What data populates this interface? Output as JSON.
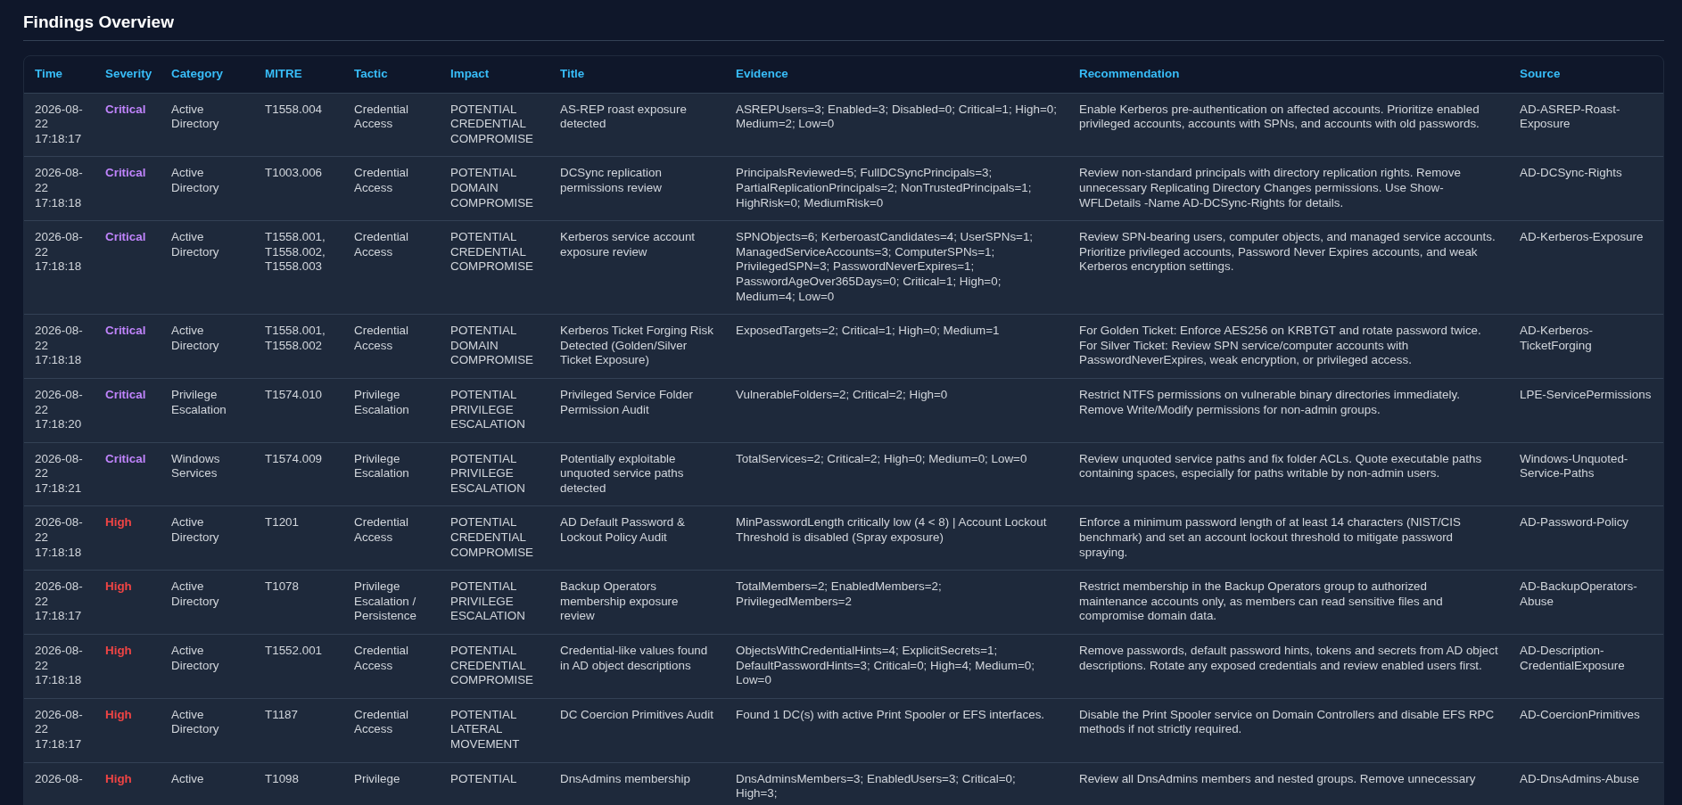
{
  "heading": "Findings Overview",
  "table": {
    "columns": [
      "Time",
      "Severity",
      "Category",
      "MITRE",
      "Tactic",
      "Impact",
      "Title",
      "Evidence",
      "Recommendation",
      "Source"
    ],
    "rows": [
      {
        "time": "2026-08-22 17:18:17",
        "severity": "Critical",
        "color": "#c084fc",
        "category": "Active Directory",
        "mitre": "T1558.004",
        "tactic": "Credential Access",
        "impact": "POTENTIAL CREDENTIAL COMPROMISE",
        "title": "AS-REP roast exposure detected",
        "evidence": "ASREPUsers=3; Enabled=3; Disabled=0; Critical=1; High=0; Medium=2; Low=0",
        "recommendation": "Enable Kerberos pre-authentication on affected accounts. Prioritize enabled privileged accounts, accounts with SPNs, and accounts with old passwords.",
        "source": "AD-ASREP-Roast-Exposure"
      },
      {
        "time": "2026-08-22 17:18:18",
        "severity": "Critical",
        "color": "#c084fc",
        "category": "Active Directory",
        "mitre": "T1003.006",
        "tactic": "Credential Access",
        "impact": "POTENTIAL DOMAIN COMPROMISE",
        "title": "DCSync replication permissions review",
        "evidence": "PrincipalsReviewed=5; FullDCSyncPrincipals=3; PartialReplicationPrincipals=2; NonTrustedPrincipals=1; HighRisk=0; MediumRisk=0",
        "recommendation": "Review non-standard principals with directory replication rights. Remove unnecessary Replicating Directory Changes permissions. Use Show-WFLDetails -Name AD-DCSync-Rights for details.",
        "source": "AD-DCSync-Rights"
      },
      {
        "time": "2026-08-22 17:18:18",
        "severity": "Critical",
        "color": "#c084fc",
        "category": "Active Directory",
        "mitre": "T1558.001, T1558.002, T1558.003",
        "tactic": "Credential Access",
        "impact": "POTENTIAL CREDENTIAL COMPROMISE",
        "title": "Kerberos service account exposure review",
        "evidence": "SPNObjects=6; KerberoastCandidates=4; UserSPNs=1; ManagedServiceAccounts=3; ComputerSPNs=1; PrivilegedSPN=3; PasswordNeverExpires=1; PasswordAgeOver365Days=0; Critical=1; High=0; Medium=4; Low=0",
        "recommendation": "Review SPN-bearing users, computer objects, and managed service accounts. Prioritize privileged accounts, Password Never Expires accounts, and weak Kerberos encryption settings.",
        "source": "AD-Kerberos-Exposure"
      },
      {
        "time": "2026-08-22 17:18:18",
        "severity": "Critical",
        "color": "#c084fc",
        "category": "Active Directory",
        "mitre": "T1558.001, T1558.002",
        "tactic": "Credential Access",
        "impact": "POTENTIAL DOMAIN COMPROMISE",
        "title": "Kerberos Ticket Forging Risk Detected (Golden/Silver Ticket Exposure)",
        "evidence": "ExposedTargets=2; Critical=1; High=0; Medium=1",
        "recommendation": "For Golden Ticket: Enforce AES256 on KRBTGT and rotate password twice. For Silver Ticket: Review SPN service/computer accounts with PasswordNeverExpires, weak encryption, or privileged access.",
        "source": "AD-Kerberos-TicketForging"
      },
      {
        "time": "2026-08-22 17:18:20",
        "severity": "Critical",
        "color": "#c084fc",
        "category": "Privilege Escalation",
        "mitre": "T1574.010",
        "tactic": "Privilege Escalation",
        "impact": "POTENTIAL PRIVILEGE ESCALATION",
        "title": "Privileged Service Folder Permission Audit",
        "evidence": "VulnerableFolders=2; Critical=2; High=0",
        "recommendation": "Restrict NTFS permissions on vulnerable binary directories immediately. Remove Write/Modify permissions for non-admin groups.",
        "source": "LPE-ServicePermissions"
      },
      {
        "time": "2026-08-22 17:18:21",
        "severity": "Critical",
        "color": "#c084fc",
        "category": "Windows Services",
        "mitre": "T1574.009",
        "tactic": "Privilege Escalation",
        "impact": "POTENTIAL PRIVILEGE ESCALATION",
        "title": "Potentially exploitable unquoted service paths detected",
        "evidence": "TotalServices=2; Critical=2; High=0; Medium=0; Low=0",
        "recommendation": "Review unquoted service paths and fix folder ACLs. Quote executable paths containing spaces, especially for paths writable by non-admin users.",
        "source": "Windows-Unquoted-Service-Paths"
      },
      {
        "time": "2026-08-22 17:18:18",
        "severity": "High",
        "color": "#ef4444",
        "category": "Active Directory",
        "mitre": "T1201",
        "tactic": "Credential Access",
        "impact": "POTENTIAL CREDENTIAL COMPROMISE",
        "title": "AD Default Password & Lockout Policy Audit",
        "evidence": "MinPasswordLength critically low (4 < 8) | Account Lockout Threshold is disabled (Spray exposure)",
        "recommendation": "Enforce a minimum password length of at least 14 characters (NIST/CIS benchmark) and set an account lockout threshold to mitigate password spraying.",
        "source": "AD-Password-Policy"
      },
      {
        "time": "2026-08-22 17:18:17",
        "severity": "High",
        "color": "#ef4444",
        "category": "Active Directory",
        "mitre": "T1078",
        "tactic": "Privilege Escalation / Persistence",
        "impact": "POTENTIAL PRIVILEGE ESCALATION",
        "title": "Backup Operators membership exposure review",
        "evidence": "TotalMembers=2; EnabledMembers=2; PrivilegedMembers=2",
        "recommendation": "Restrict membership in the Backup Operators group to authorized maintenance accounts only, as members can read sensitive files and compromise domain data.",
        "source": "AD-BackupOperators-Abuse"
      },
      {
        "time": "2026-08-22 17:18:18",
        "severity": "High",
        "color": "#ef4444",
        "category": "Active Directory",
        "mitre": "T1552.001",
        "tactic": "Credential Access",
        "impact": "POTENTIAL CREDENTIAL COMPROMISE",
        "title": "Credential-like values found in AD object descriptions",
        "evidence": "ObjectsWithCredentialHints=4; ExplicitSecrets=1; DefaultPasswordHints=3; Critical=0; High=4; Medium=0; Low=0",
        "recommendation": "Remove passwords, default password hints, tokens and secrets from AD object descriptions. Rotate any exposed credentials and review enabled users first.",
        "source": "AD-Description-CredentialExposure"
      },
      {
        "time": "2026-08-22 17:18:17",
        "severity": "High",
        "color": "#ef4444",
        "category": "Active Directory",
        "mitre": "T1187",
        "tactic": "Credential Access",
        "impact": "POTENTIAL LATERAL MOVEMENT",
        "title": "DC Coercion Primitives Audit",
        "evidence": "Found 1 DC(s) with active Print Spooler or EFS interfaces.",
        "recommendation": "Disable the Print Spooler service on Domain Controllers and disable EFS RPC methods if not strictly required.",
        "source": "AD-CoercionPrimitives"
      },
      {
        "time": "2026-08-",
        "severity": "High",
        "color": "#ef4444",
        "category": "Active",
        "mitre": "T1098",
        "tactic": "Privilege",
        "impact": "POTENTIAL",
        "title": "DnsAdmins membership",
        "evidence": "DnsAdminsMembers=3; EnabledUsers=3; Critical=0; High=3;",
        "recommendation": "Review all DnsAdmins members and nested groups. Remove unnecessary",
        "source": "AD-DnsAdmins-Abuse"
      }
    ]
  }
}
